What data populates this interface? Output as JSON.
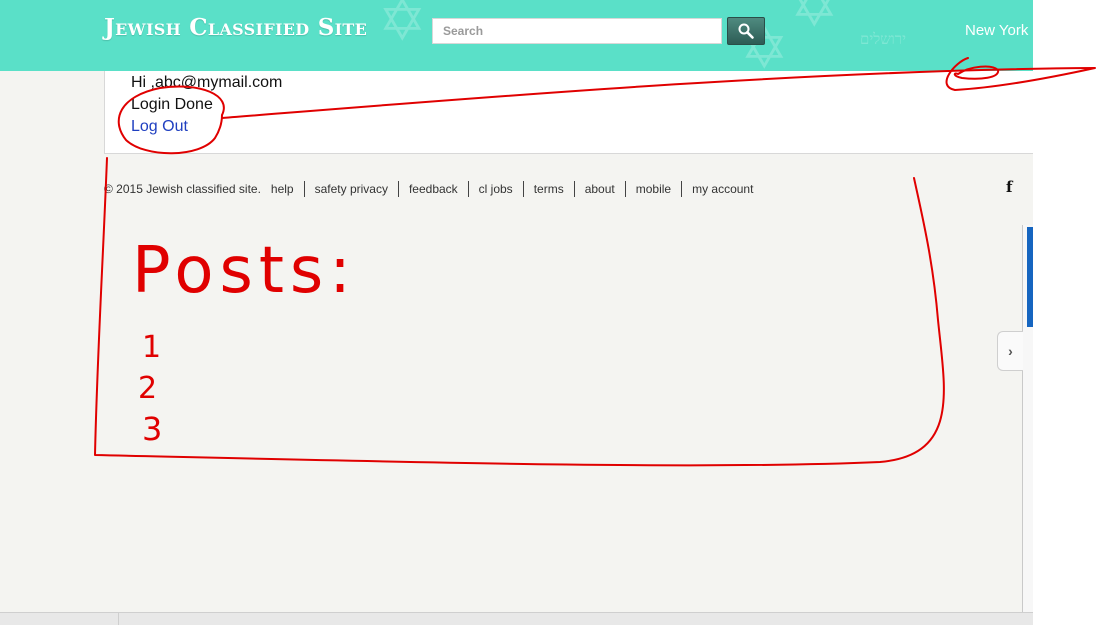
{
  "header": {
    "brand": "Jewish Classified Site",
    "search_placeholder": "Search",
    "city": "New York",
    "decoration_text": "ירושלים"
  },
  "user_panel": {
    "greeting": "Hi ,abc@mymail.com",
    "status": "Login Done",
    "logout_label": "Log Out"
  },
  "footer": {
    "copyright": "© 2015 Jewish classified site.",
    "links": [
      "help",
      "safety privacy",
      "feedback",
      "cl jobs",
      "terms",
      "about",
      "mobile",
      "my account"
    ],
    "facebook_label": "f"
  },
  "annotation": {
    "title": "Posts:",
    "items": [
      "1",
      "2",
      "3"
    ]
  },
  "colors": {
    "header_bg": "#5ae0c8",
    "link": "#1f3fc0",
    "annotation": "#e00000"
  },
  "icons": [
    "search-icon",
    "facebook-icon",
    "chevron-right-icon",
    "star-of-david-icon"
  ]
}
